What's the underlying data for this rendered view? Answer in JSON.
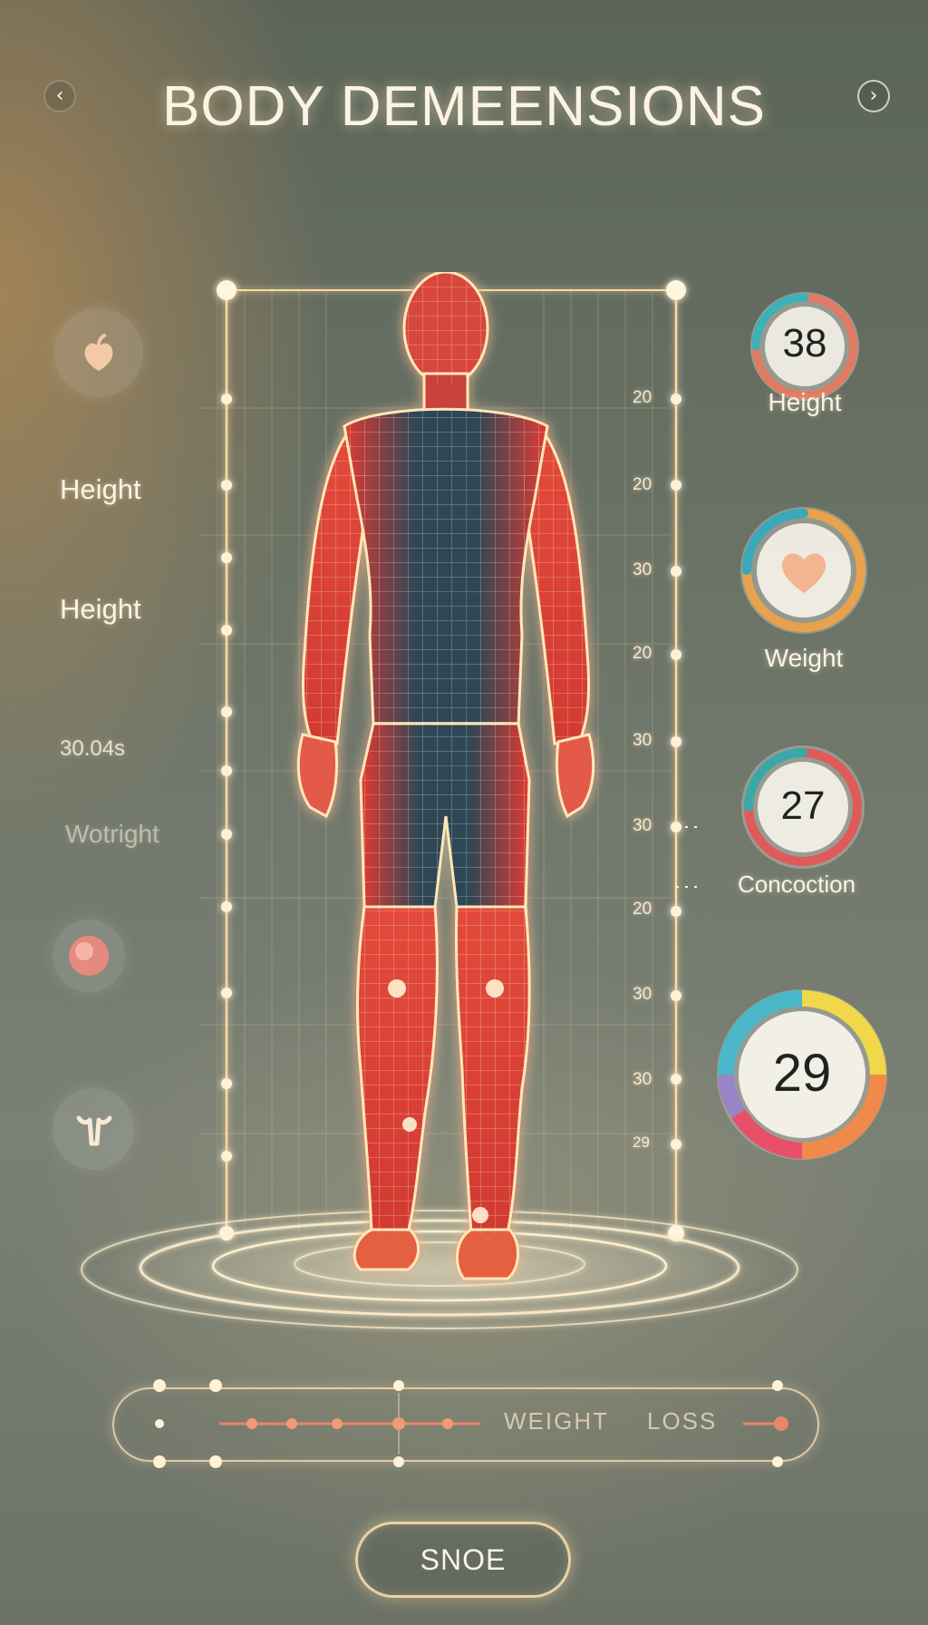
{
  "header": {
    "title": "BODY DEMEENSIONS",
    "back_icon": "chevron-left-icon",
    "forward_icon": "chevron-right-icon",
    "back_glyph": "‹",
    "forward_glyph": "›"
  },
  "sidebar": {
    "icons": [
      "leaf-icon",
      "circle-dot-icon",
      "tool-icon"
    ],
    "labels": [
      "Height",
      "Height",
      "30.04s",
      "Wotright"
    ]
  },
  "scale": {
    "tick_labels": [
      "20",
      "20",
      "30",
      "20",
      "30",
      "30",
      "20",
      "30",
      "30",
      "29"
    ]
  },
  "gauges": [
    {
      "value": "38",
      "label": "Height",
      "progress": 0.75,
      "color": "#e07a62"
    },
    {
      "value": "",
      "label": "Weight",
      "progress": 0.8,
      "color": "#e8a24c",
      "icon": "heart-icon"
    },
    {
      "value": "27",
      "label": "Concoction",
      "progress": 0.85,
      "color": "#e05a5a"
    },
    {
      "value": "29",
      "label": "",
      "progress": 1.0,
      "color": "multicolor"
    }
  ],
  "bottom": {
    "slider_label_1": "WEIGHT",
    "slider_label_2": "LOSS",
    "button_label": "SNOE"
  },
  "colors": {
    "accent_glow": "#ffe3ad",
    "figure_red": "#e0483c",
    "figure_blue": "#2f4658"
  }
}
